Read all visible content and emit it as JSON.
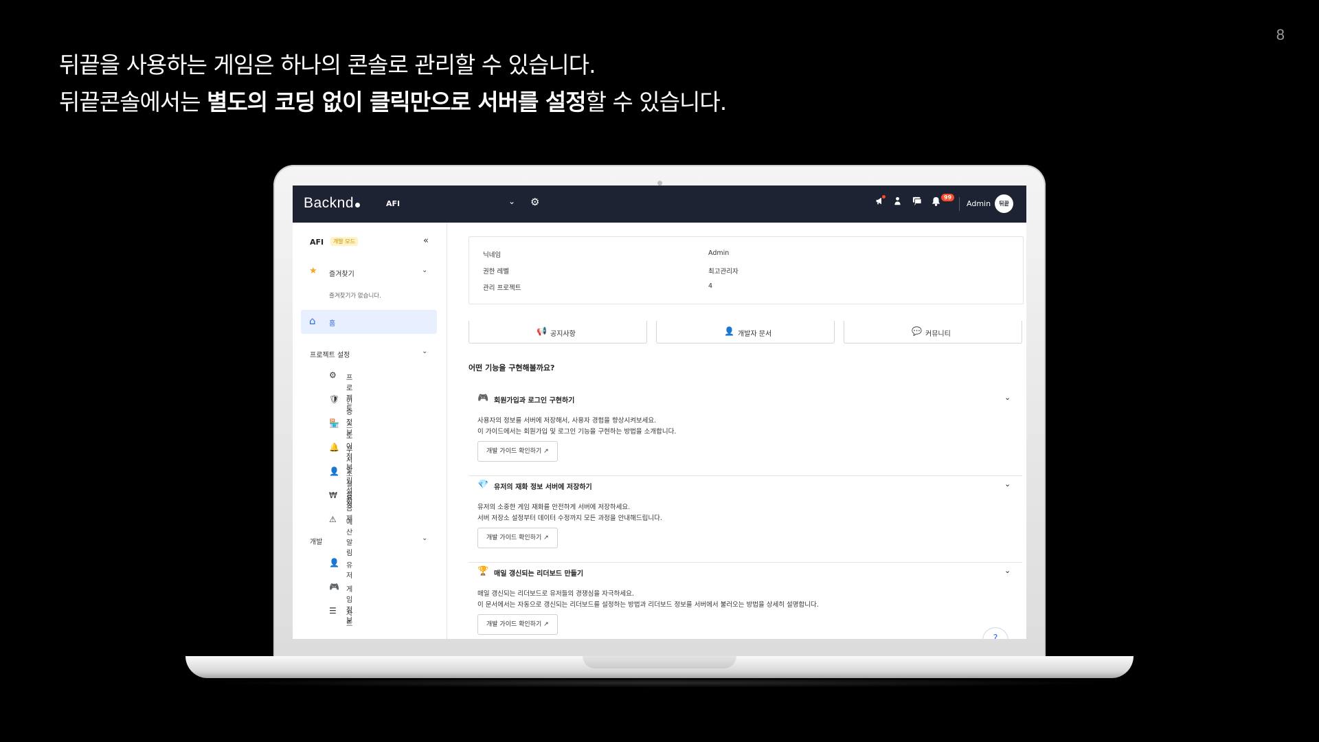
{
  "slide": {
    "page_number": "8",
    "line1": "뒤끝을 사용하는 게임은 하나의 콘솔로 관리할 수 있습니다.",
    "line2_prefix": "뒤끝콘솔에서는 ",
    "line2_bold": "별도의 코딩 없이 클릭만으로 서버를 설정",
    "line2_suffix": "할 수 있습니다."
  },
  "topbar": {
    "logo": "Backnd",
    "project": "AFI",
    "chevron": "⌄",
    "gear": "⚙",
    "icons": [
      "megaphone-icon",
      "developer-icon",
      "chat-icon",
      "bell-icon"
    ],
    "notification_count": "99",
    "user": "Admin",
    "avatar_text": "뒤끝"
  },
  "sidebar": {
    "project": "AFI",
    "mode_badge": "개발 모드",
    "collapse": "«",
    "favorites_label": "즐겨찾기",
    "favorites_empty": "즐겨찾기가 없습니다.",
    "home_label": "홈",
    "section_project": "프로젝트 설정",
    "project_items": [
      {
        "icon": "⚙",
        "label": "프로젝트"
      },
      {
        "icon": "🛡",
        "label": "인증 정보"
      },
      {
        "icon": "🏪",
        "label": "스토어 정보"
      },
      {
        "icon": "🔔",
        "label": "푸시 알림 설정"
      },
      {
        "icon": "👤",
        "label": "소셜 설정"
      },
      {
        "icon": "₩",
        "label": "요금제"
      },
      {
        "icon": "⚠",
        "label": "예산 알림"
      }
    ],
    "section_dev": "개발",
    "dev_items": [
      {
        "icon": "👤",
        "label": "유저"
      },
      {
        "icon": "🎮",
        "label": "게임 정보"
      },
      {
        "icon": "☰",
        "label": "차트"
      }
    ]
  },
  "info": {
    "rows": [
      {
        "key": "닉네임",
        "value": "Admin"
      },
      {
        "key": "권한 레벨",
        "value": "최고관리자"
      },
      {
        "key": "관리 프로젝트",
        "value": "4"
      }
    ]
  },
  "quick": {
    "notice": "공지사항",
    "docs": "개발자 문서",
    "community": "커뮤니티"
  },
  "features": {
    "question": "어떤 기능을 구현해볼까요?",
    "items": [
      {
        "title": "회원가입과 로그인 구현하기",
        "desc1": "사용자의 정보를 서버에 저장해서, 사용자 경험을 향상시켜보세요.",
        "desc2": "이 가이드에서는 회원가입 및 로그인 기능을 구현하는 방법을 소개합니다.",
        "button": "개발 가이드 확인하기"
      },
      {
        "title": "유저의 재화 정보 서버에 저장하기",
        "desc1": "유저의 소중한 게임 재화를 안전하게 서버에 저장하세요.",
        "desc2": "서버 저장소 설정부터 데이터 수정까지 모든 과정을 안내해드립니다.",
        "button": "개발 가이드 확인하기"
      },
      {
        "title": "매일 갱신되는 리더보드 만들기",
        "desc1": "매일 갱신되는 리더보드로 유저들의 경쟁심을 자극하세요.",
        "desc2": "이 문서에서는 자동으로 갱신되는 리더보드를 설정하는 방법과 리더보드 정보를 서버에서 불러오는 방법을 상세히 설명합니다.",
        "button": "개발 가이드 확인하기"
      }
    ]
  },
  "colors": {
    "topbar": "#1d2333",
    "accent": "#2c6bed",
    "badge": "#ff4b2b"
  }
}
